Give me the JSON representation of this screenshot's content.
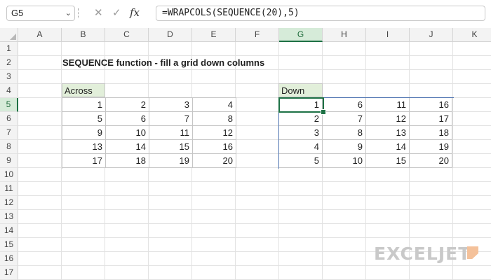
{
  "formula_bar": {
    "name_box": "G5",
    "formula": "=WRAPCOLS(SEQUENCE(20),5)",
    "icons": [
      "more-options-icon",
      "cancel-icon",
      "confirm-icon",
      "insert-function-icon"
    ],
    "fx_label": "fx"
  },
  "sheet": {
    "columns": [
      "A",
      "B",
      "C",
      "D",
      "E",
      "F",
      "G",
      "H",
      "I",
      "J",
      "K"
    ],
    "rows": [
      "1",
      "2",
      "3",
      "4",
      "5",
      "6",
      "7",
      "8",
      "9",
      "10",
      "11",
      "12",
      "13",
      "14",
      "15",
      "16",
      "17"
    ],
    "selected_column": "G",
    "selected_row": "5",
    "title": "SEQUENCE function - fill a grid down columns",
    "across": {
      "label": "Across",
      "rows": [
        [
          "1",
          "2",
          "3",
          "4"
        ],
        [
          "5",
          "6",
          "7",
          "8"
        ],
        [
          "9",
          "10",
          "11",
          "12"
        ],
        [
          "13",
          "14",
          "15",
          "16"
        ],
        [
          "17",
          "18",
          "19",
          "20"
        ]
      ]
    },
    "down": {
      "label": "Down",
      "rows": [
        [
          "1",
          "6",
          "11",
          "16"
        ],
        [
          "2",
          "7",
          "12",
          "17"
        ],
        [
          "3",
          "8",
          "13",
          "18"
        ],
        [
          "4",
          "9",
          "14",
          "19"
        ],
        [
          "5",
          "10",
          "15",
          "20"
        ]
      ]
    }
  },
  "watermark": {
    "text": "EXCELJET",
    "color": "#c9c9c9",
    "accent": "#f4c19a"
  },
  "colors": {
    "header_bg": "#f3f3f3",
    "selected_header": "#d6ebd9",
    "label_fill": "#e2efda",
    "accent_green": "#1e7145",
    "spill_border": "#4c72b0"
  }
}
